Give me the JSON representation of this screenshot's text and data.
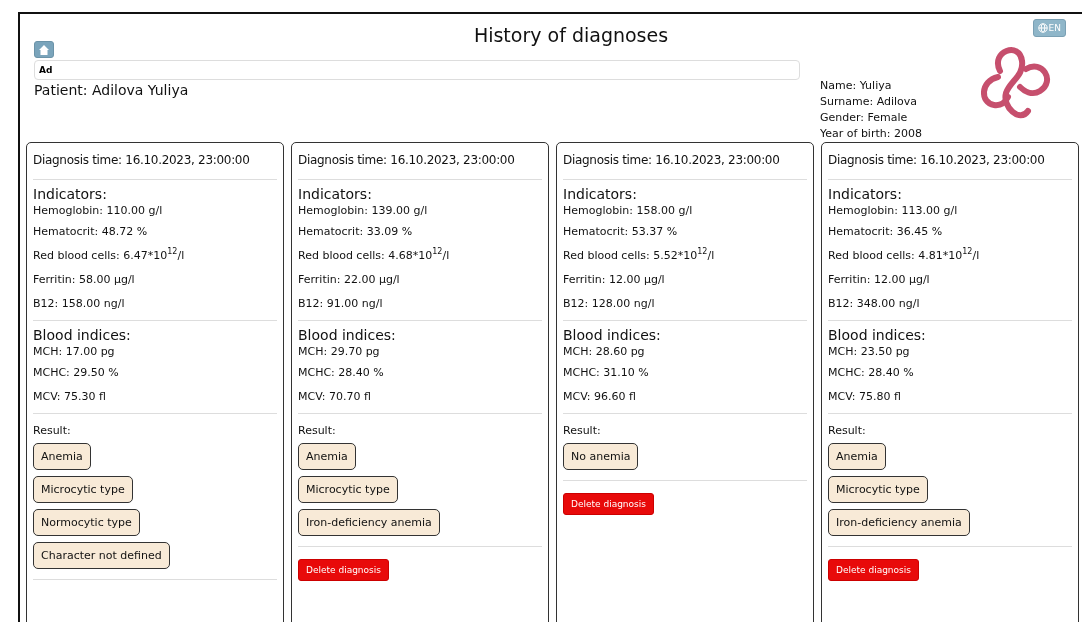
{
  "header": {
    "title": "History of diagnoses",
    "language_button": "EN",
    "search": {
      "value": "Ad"
    },
    "patient": "Patient: Adilova Yuliya",
    "patient_info": [
      "Name: Yuliya",
      "Surname: Adilova",
      "Gender: Female",
      "Year of birth: 2008"
    ]
  },
  "diagnoses": [
    {
      "time": "Diagnosis time: 16.10.2023, 23:00:00",
      "indicators_title": "Indicators:",
      "indicators": [
        "Hemoglobin: 110.00 g/l",
        "Hematocrit: 48.72 %",
        "Red blood cells: 6.47*10$^{12}$/l",
        "Ferritin: 58.00 µg/l",
        "B12: 158.00 ng/l"
      ],
      "indices_title": "Blood indices:",
      "indices": [
        "MCH: 17.00 pg",
        "MCHC: 29.50 %",
        "MCV: 75.30 fl"
      ],
      "result_label": "Result:",
      "results": [
        "Anemia",
        "Microcytic type",
        "Normocytic type",
        "Character not defined"
      ]
    },
    {
      "time": "Diagnosis time: 16.10.2023, 23:00:00",
      "indicators_title": "Indicators:",
      "indicators": [
        "Hemoglobin: 139.00 g/l",
        "Hematocrit: 33.09 %",
        "Red blood cells: 4.68*10$^{12}$/l",
        "Ferritin: 22.00 µg/l",
        "B12: 91.00 ng/l"
      ],
      "indices_title": "Blood indices:",
      "indices": [
        "MCH: 29.70 pg",
        "MCHC: 28.40 %",
        "MCV: 70.70 fl"
      ],
      "result_label": "Result:",
      "results": [
        "Anemia",
        "Microcytic type",
        "Iron-deficiency anemia"
      ],
      "delete_button": "Delete diagnosis"
    },
    {
      "time": "Diagnosis time: 16.10.2023, 23:00:00",
      "indicators_title": "Indicators:",
      "indicators": [
        "Hemoglobin: 158.00 g/l",
        "Hematocrit: 53.37 %",
        "Red blood cells: 5.52*10$^{12}$/l",
        "Ferritin: 12.00 µg/l",
        "B12: 128.00 ng/l"
      ],
      "indices_title": "Blood indices:",
      "indices": [
        "MCH: 28.60 pg",
        "MCHC: 31.10 %",
        "MCV: 96.60 fl"
      ],
      "result_label": "Result:",
      "results": [
        "No anemia"
      ],
      "delete_button": "Delete diagnosis"
    },
    {
      "time": "Diagnosis time: 16.10.2023, 23:00:00",
      "indicators_title": "Indicators:",
      "indicators": [
        "Hemoglobin: 113.00 g/l",
        "Hematocrit: 36.45 %",
        "Red blood cells: 4.81*10$^{12}$/l",
        "Ferritin: 12.00 µg/l",
        "B12: 348.00 ng/l"
      ],
      "indices_title": "Blood indices:",
      "indices": [
        "MCH: 23.50 pg",
        "MCHC: 28.40 %",
        "MCV: 75.80 fl"
      ],
      "result_label": "Result:",
      "results": [
        "Anemia",
        "Microcytic type",
        "Iron-deficiency anemia"
      ],
      "delete_button": "Delete diagnosis"
    }
  ]
}
